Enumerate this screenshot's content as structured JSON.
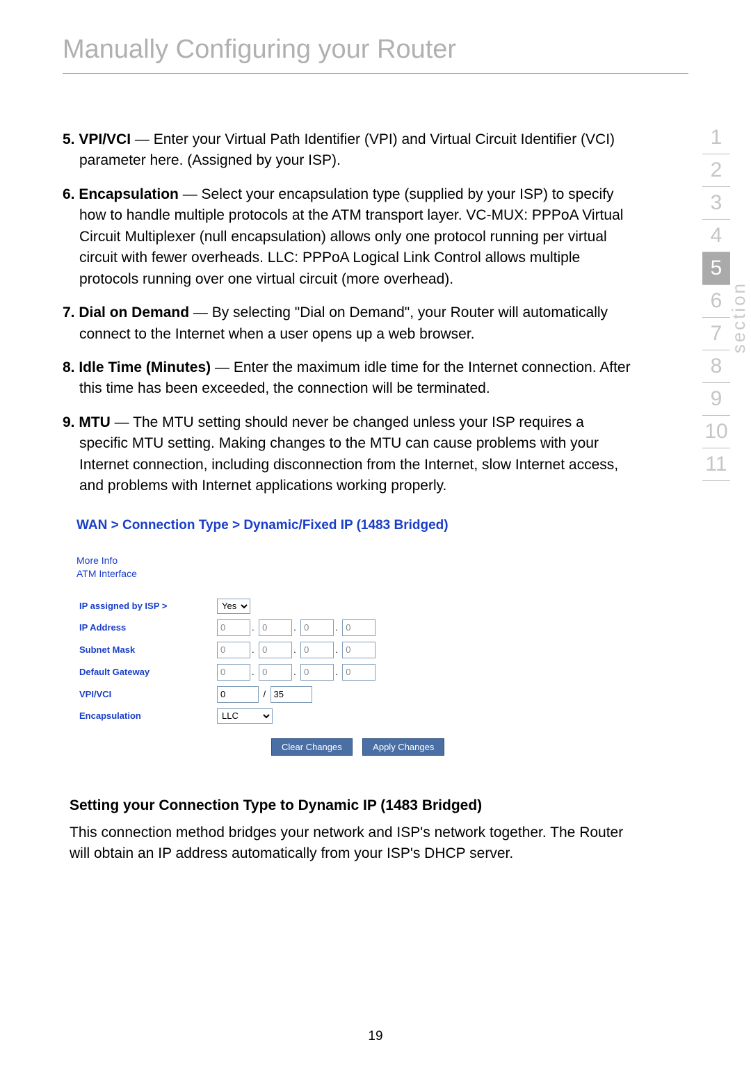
{
  "header": {
    "title": "Manually Configuring your Router"
  },
  "items": {
    "5": {
      "label": "5. VPI/VCI",
      "text": " — Enter your Virtual Path Identifier (VPI) and Virtual Circuit Identifier (VCI) parameter here. (Assigned by your ISP)."
    },
    "6": {
      "label": "6. Encapsulation",
      "text": " — Select your encapsulation type (supplied by your ISP) to specify how to handle multiple protocols at the ATM transport layer. VC-MUX: PPPoA Virtual Circuit Multiplexer (null encapsulation) allows only one protocol running per virtual circuit with fewer overheads. LLC: PPPoA Logical Link Control allows multiple protocols running over one virtual circuit (more overhead)."
    },
    "7": {
      "label": "7. Dial on Demand",
      "text": " — By selecting \"Dial on Demand\", your Router will automatically connect to the Internet when a user opens up a web browser."
    },
    "8": {
      "label": "8. Idle Time (Minutes)",
      "text": " — Enter the maximum idle time for the Internet connection. After this time has been exceeded, the connection will be terminated."
    },
    "9": {
      "label": "9. MTU",
      "text": " — The MTU setting should never be changed unless your ISP requires a specific MTU setting. Making changes to the MTU can cause problems with your Internet connection, including disconnection from the Internet, slow Internet access, and problems with Internet applications working properly."
    }
  },
  "screenshot": {
    "breadcrumb": "WAN > Connection Type > Dynamic/Fixed IP (1483 Bridged)",
    "more_info_l1": "More Info",
    "more_info_l2": "ATM Interface",
    "labels": {
      "ip_assigned": "IP assigned by ISP >",
      "ip_address": "IP Address",
      "subnet_mask": "Subnet Mask",
      "default_gateway": "Default Gateway",
      "vpi_vci": "VPI/VCI",
      "encapsulation": "Encapsulation"
    },
    "values": {
      "ip_assigned_selected": "Yes",
      "ip1": "0",
      "ip2": "0",
      "ip3": "0",
      "ip4": "0",
      "sm1": "0",
      "sm2": "0",
      "sm3": "0",
      "sm4": "0",
      "gw1": "0",
      "gw2": "0",
      "gw3": "0",
      "gw4": "0",
      "vpi": "0",
      "vci": "35",
      "encap_selected": "LLC",
      "slash": "/"
    },
    "buttons": {
      "clear": "Clear Changes",
      "apply": "Apply Changes"
    }
  },
  "subsection": {
    "heading": "Setting your Connection Type to Dynamic IP (1483 Bridged)",
    "body": "This connection method bridges your network and ISP's network together. The Router will obtain an IP address automatically from your ISP's DHCP server."
  },
  "sidebar": {
    "label": "section",
    "items": [
      "1",
      "2",
      "3",
      "4",
      "5",
      "6",
      "7",
      "8",
      "9",
      "10",
      "11"
    ],
    "active": "5"
  },
  "page_number": "19"
}
